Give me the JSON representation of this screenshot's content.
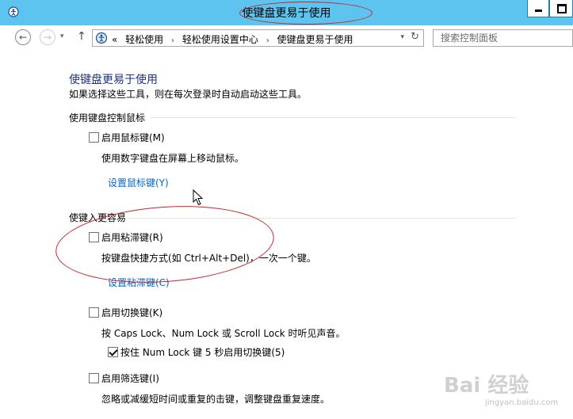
{
  "window": {
    "title": "使键盘更易于使用"
  },
  "navigation": {
    "breadcrumb_prefix": "«",
    "breadcrumbs": [
      "轻松使用",
      "轻松使用设置中心",
      "使键盘更易于使用"
    ],
    "separator": "›",
    "search_placeholder": "搜索控制面板"
  },
  "page": {
    "heading": "使键盘更易于使用",
    "description": "如果选择这些工具，则在每次登录时自动启动这些工具。"
  },
  "sections": [
    {
      "title": "使用键盘控制鼠标",
      "options": [
        {
          "label": "启用鼠标键(M)",
          "checked": false,
          "description": "使用数字键盘在屏幕上移动鼠标。",
          "link": "设置鼠标键(Y)"
        }
      ]
    },
    {
      "title": "使键入更容易",
      "options": [
        {
          "label": "启用粘滞键(R)",
          "checked": false,
          "description": "按键盘快捷方式(如 Ctrl+Alt+Del)，一次一个键。",
          "link": "设置粘滞键(C)"
        },
        {
          "label": "启用切换键(K)",
          "checked": false,
          "description": "按 Caps Lock、Num Lock 或 Scroll Lock 时听见声音。",
          "suboption": {
            "label": "按住 Num Lock 键 5 秒启用切换键(5)",
            "checked": true
          }
        },
        {
          "label": "启用筛选键(I)",
          "checked": false,
          "description": "忽略或减缓短时间或重复的击键，调整键盘重复速度。"
        }
      ]
    }
  ],
  "watermark": {
    "text": "Bai 经验",
    "subtext": "jingyan.baidu.com"
  },
  "colors": {
    "titlebar": "#5cc4ee",
    "heading": "#1e3287",
    "link": "#0066cc",
    "annotation": "#c8242a"
  }
}
